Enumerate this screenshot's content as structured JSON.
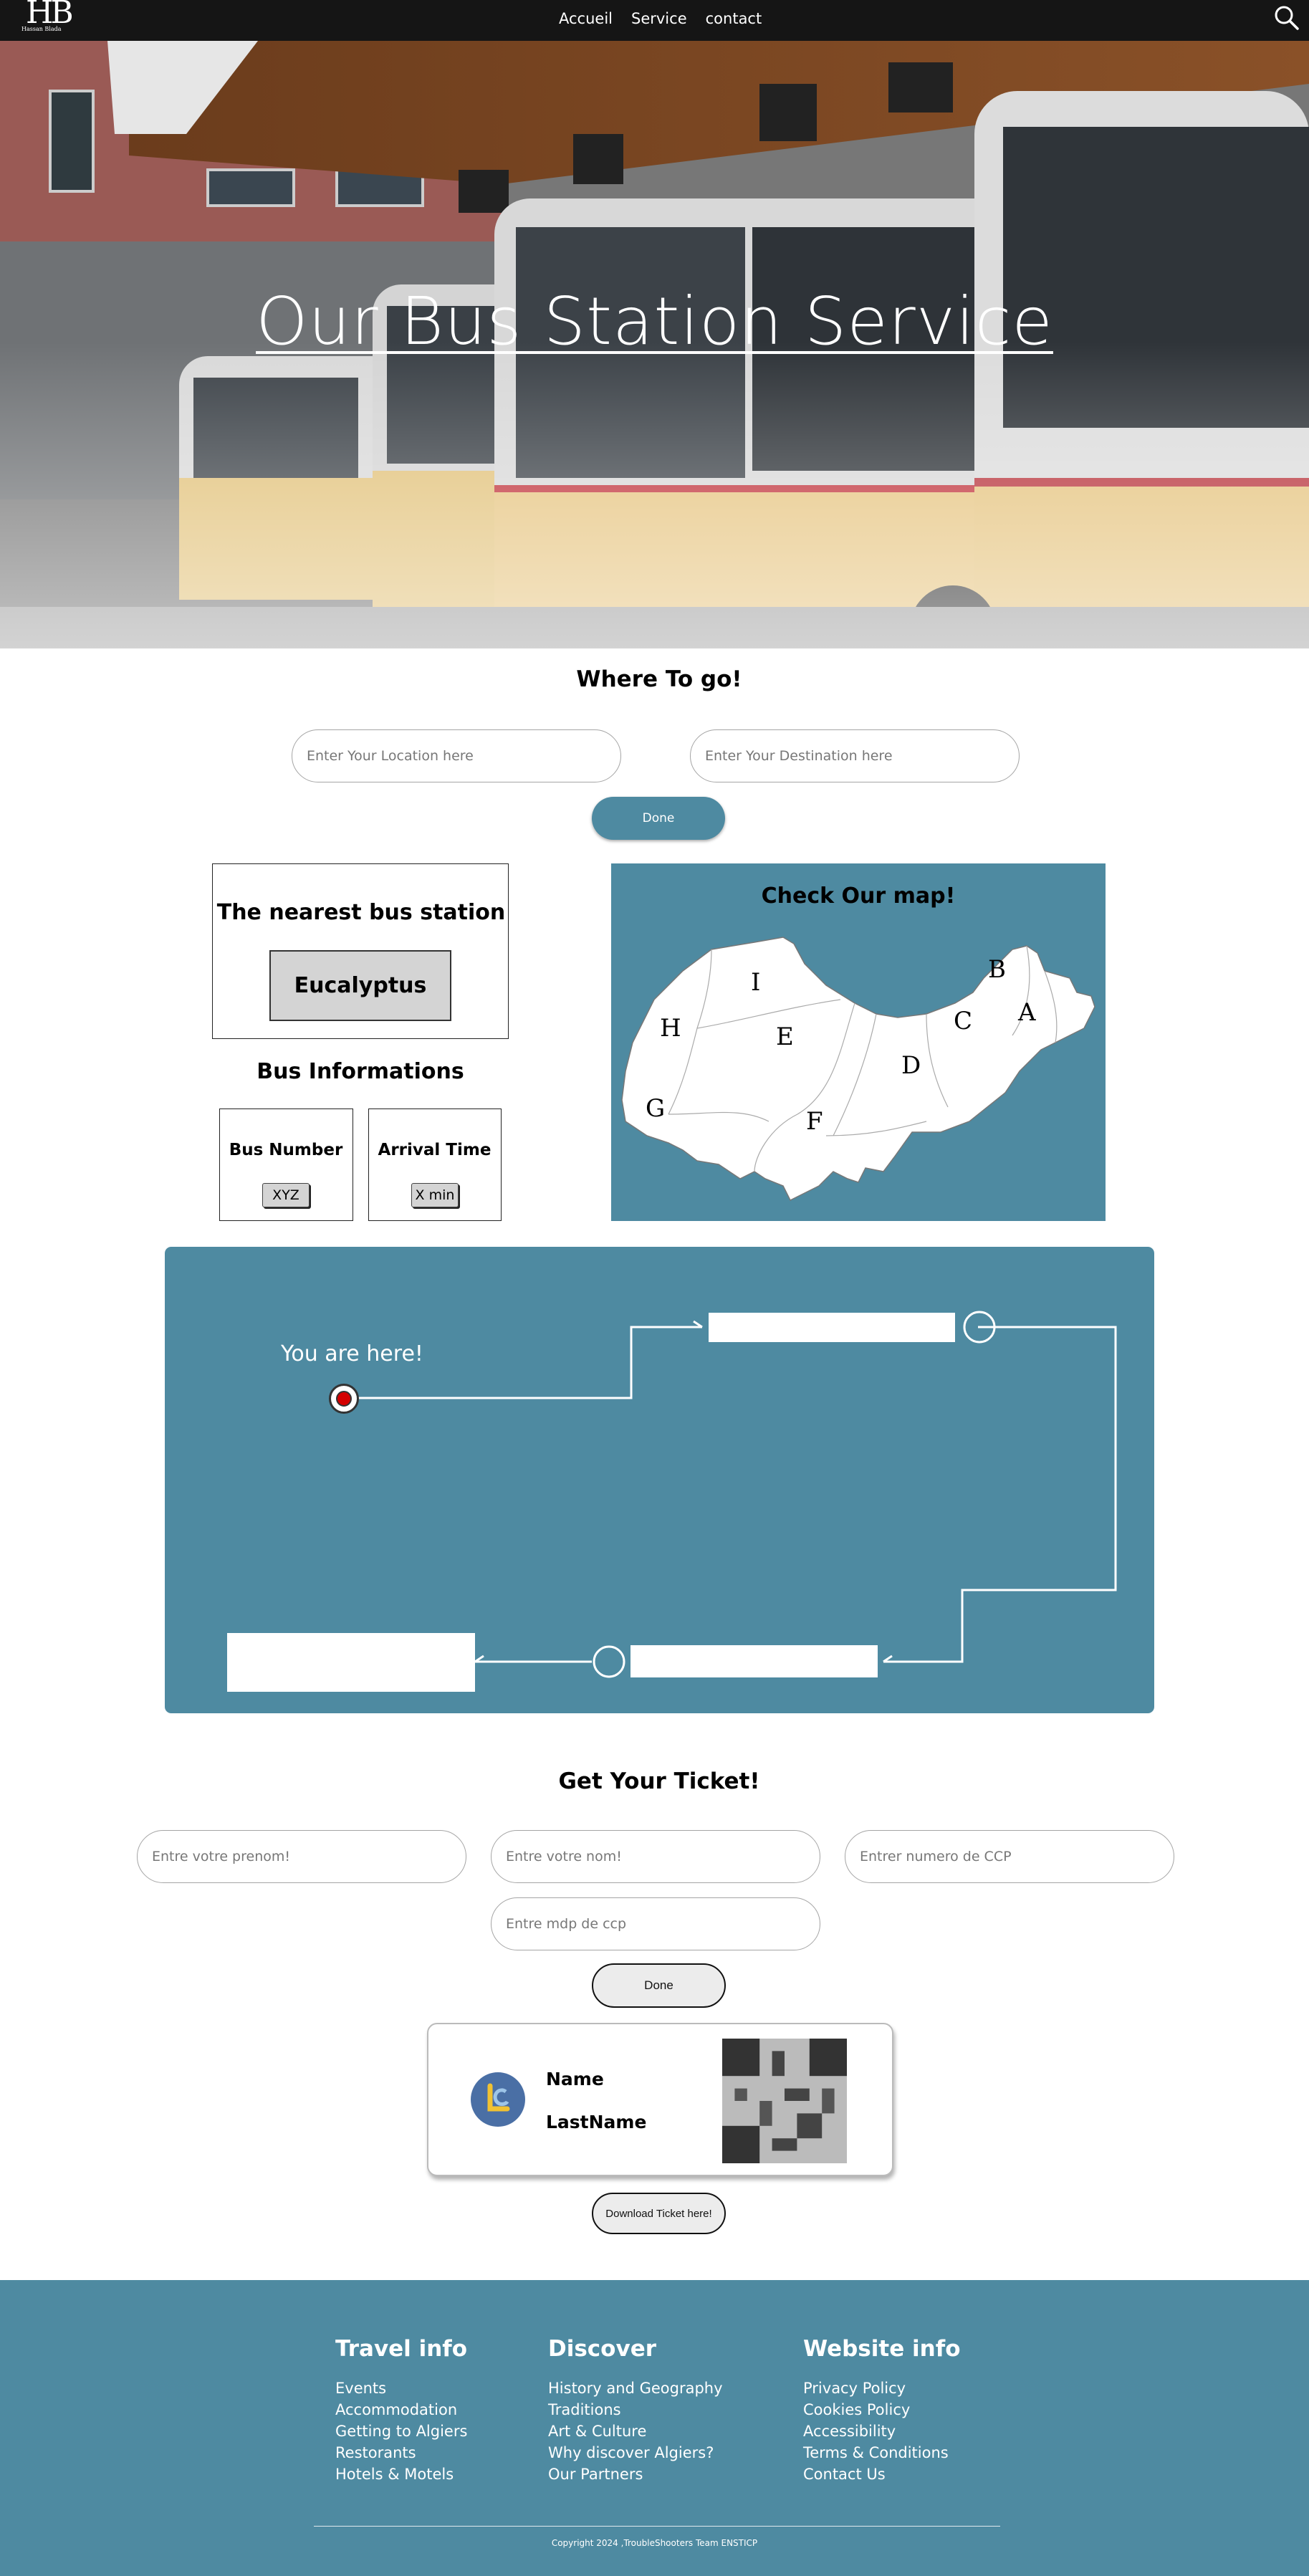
{
  "nav": {
    "logo_mark": "HB",
    "logo_sub": "Hassan Blada",
    "links": [
      "Accueil",
      "Service",
      "contact"
    ]
  },
  "hero": {
    "title": "Our Bus Station Service"
  },
  "where": {
    "title": "Where To go!",
    "location_placeholder": "Enter Your Location here",
    "destination_placeholder": "Enter Your Destination here",
    "done_label": "Done"
  },
  "nearest": {
    "title": "The nearest bus station",
    "station": "Eucalyptus"
  },
  "bus_info": {
    "title": "Bus Informations",
    "number_label": "Bus Number",
    "number_value": "XYZ",
    "arrival_label": "Arrival Time",
    "arrival_value": "X min"
  },
  "map": {
    "title": "Check Our map!",
    "regions": [
      "A",
      "B",
      "C",
      "D",
      "E",
      "F",
      "G",
      "H",
      "I"
    ]
  },
  "route": {
    "you_are_here": "You are here!"
  },
  "ticket": {
    "title": "Get Your Ticket!",
    "prenom_placeholder": "Entre votre prenom!",
    "nom_placeholder": "Entre votre nom!",
    "ccp_placeholder": "Entrer numero de CCP",
    "mdp_placeholder": "Entre mdp de ccp",
    "done_label": "Done",
    "name_label": "Name",
    "lastname_label": "LastName",
    "download_label": "Download Ticket here!"
  },
  "footer": {
    "columns": [
      {
        "title": "Travel info",
        "items": [
          "Events",
          "Accommodation",
          "Getting to Algiers",
          "Restorants",
          "Hotels & Motels"
        ]
      },
      {
        "title": "Discover",
        "items": [
          "History and Geography",
          "Traditions",
          "Art & Culture",
          "Why discover Algiers?",
          "Our Partners"
        ]
      },
      {
        "title": "Website info",
        "items": [
          "Privacy Policy",
          "Cookies Policy",
          "Accessibility",
          "Terms & Conditions",
          "Contact Us"
        ]
      }
    ],
    "copyright": "Copyright 2024 ,TroubleShooters Team ENSTICP"
  },
  "colors": {
    "teal": "#4e8aa1",
    "nav_bg": "#151515",
    "bus_yellow": "#e2c27a"
  }
}
